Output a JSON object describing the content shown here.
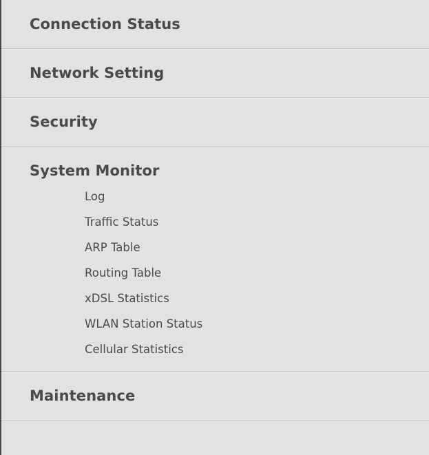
{
  "menu": {
    "sections": [
      {
        "label": "Connection Status"
      },
      {
        "label": "Network Setting"
      },
      {
        "label": "Security"
      },
      {
        "label": "System Monitor",
        "items": [
          {
            "label": "Log"
          },
          {
            "label": "Traffic Status"
          },
          {
            "label": "ARP Table"
          },
          {
            "label": "Routing Table"
          },
          {
            "label": "xDSL Statistics"
          },
          {
            "label": "WLAN Station Status"
          },
          {
            "label": "Cellular Statistics"
          }
        ]
      },
      {
        "label": "Maintenance"
      }
    ]
  }
}
